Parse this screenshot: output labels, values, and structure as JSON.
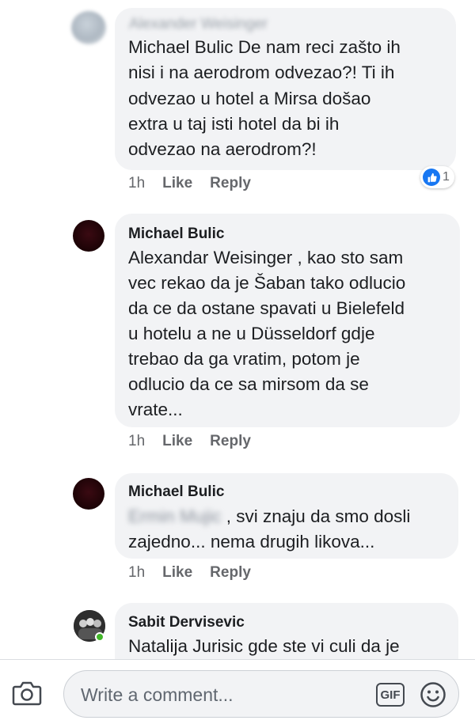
{
  "comments": [
    {
      "author": "Alexander Weisinger",
      "lines": [
        "Michael Bulic De nam reci zašto ih",
        "nisi i na aerodrom odvezao?! Ti ih",
        "odvezao u hotel a Mirsa došao",
        "extra u taj isti hotel da bi ih",
        "odvezao na aerodrom?!"
      ],
      "time": "1h",
      "like_label": "Like",
      "reply_label": "Reply",
      "reaction_count": "1"
    },
    {
      "author": "Michael Bulic",
      "lines": [
        "Alexandar Weisinger , kao sto sam",
        "vec rekao da je Šaban tako odlucio",
        "da ce da ostane spavati u Bielefeld",
        "u hotelu a ne u Düsseldorf gdje",
        "trebao da ga vratim, potom je",
        "odlucio da ce sa mirsom da se",
        "vrate..."
      ],
      "time": "1h",
      "like_label": "Like",
      "reply_label": "Reply"
    },
    {
      "author": "Michael Bulic",
      "mention": "Ermin Mujic",
      "lines": [
        ", svi znaju da smo dosli",
        "zajedno... nema drugih likova..."
      ],
      "time": "1h",
      "like_label": "Like",
      "reply_label": "Reply"
    },
    {
      "author": "Sabit Dervisevic",
      "lines": [
        "Natalija Jurisic gde ste vi culi da je"
      ]
    }
  ],
  "composer": {
    "placeholder": "Write a comment...",
    "gif_label": "GIF",
    "icons": [
      "camera-icon",
      "gif-icon",
      "smiley-icon"
    ]
  },
  "colors": {
    "bubble": "#f2f3f5",
    "like_blue": "#1877f2",
    "online_green": "#42b72a",
    "meta_grey": "#65676b"
  }
}
